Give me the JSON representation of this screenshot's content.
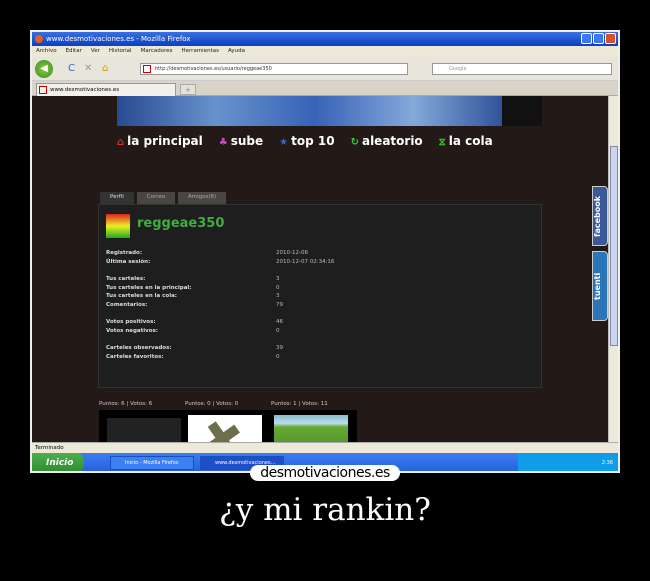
{
  "window": {
    "title": "www.desmotivaciones.es - Mozilla Firefox"
  },
  "menu": [
    "Archivo",
    "Editar",
    "Ver",
    "Historial",
    "Marcadores",
    "Herramientas",
    "Ayuda"
  ],
  "toolbar": {
    "url": "http://desmotivaciones.es/usuario/reggeae350",
    "search_placeholder": "Google"
  },
  "tab": {
    "label": "www.desmotivaciones.es",
    "new_tab": "+"
  },
  "site_nav": [
    {
      "icon": "⌂",
      "label": "la principal"
    },
    {
      "icon": "♣",
      "label": "sube"
    },
    {
      "icon": "★",
      "label": "top 10"
    },
    {
      "icon": "↻",
      "label": "aleatorio"
    },
    {
      "icon": "⧖",
      "label": "la cola"
    }
  ],
  "profile_tabs": [
    "Perfil",
    "Correo",
    "Amigos(6)"
  ],
  "profile": {
    "username": "reggeae350",
    "groups": [
      [
        {
          "k": "Registrado:",
          "v": "2010-12-06"
        },
        {
          "k": "Última sesión:",
          "v": "2010-12-07 02:34:16"
        }
      ],
      [
        {
          "k": "Tus carteles:",
          "v": "3"
        },
        {
          "k": "Tus carteles en la principal:",
          "v": "0"
        },
        {
          "k": "Tus carteles en la cola:",
          "v": "3"
        },
        {
          "k": "Comentarios:",
          "v": "79"
        }
      ],
      [
        {
          "k": "Votos positivos:",
          "v": "46"
        },
        {
          "k": "Votos negativos:",
          "v": "0"
        }
      ],
      [
        {
          "k": "Carteles observados:",
          "v": "39"
        },
        {
          "k": "Carteles favoritos:",
          "v": "0"
        }
      ]
    ]
  },
  "thumbs": [
    "Puntos: 6 | Votos: 6",
    "Puntos: 0 | Votos: 0",
    "Puntos: 1 | Votos: 11"
  ],
  "side_tabs": [
    "facebook",
    "tuenti"
  ],
  "status": "Terminado",
  "taskbar": {
    "start": "Inicio",
    "tasks": [
      "Inicio - Mozilla Firefox",
      "www.desmotivaciones..."
    ],
    "clock": "2:36"
  },
  "poster": {
    "logo": "desmotivaciones.es",
    "caption": "¿y mi rankin?"
  }
}
